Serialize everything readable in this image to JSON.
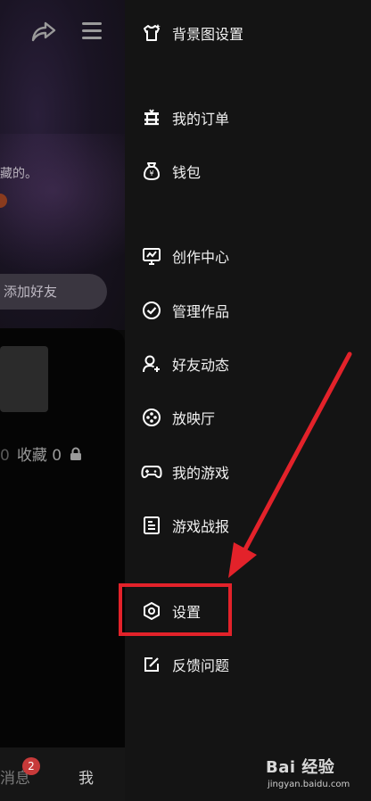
{
  "profile": {
    "bio_fragment": "藏的。",
    "add_friend_label": "添加好友",
    "favorites_partial": "0",
    "favorites_label": "收藏 0",
    "tabbar": {
      "messages_label": "消息",
      "messages_badge": "2",
      "me_label": "我"
    }
  },
  "drawer": {
    "items": [
      {
        "label": "背景图设置",
        "icon": "shirt-icon"
      },
      {
        "label": "我的订单",
        "icon": "order-icon"
      },
      {
        "label": "钱包",
        "icon": "wallet-icon"
      },
      {
        "label": "创作中心",
        "icon": "creator-icon"
      },
      {
        "label": "管理作品",
        "icon": "check-circle-icon"
      },
      {
        "label": "好友动态",
        "icon": "friend-activity-icon"
      },
      {
        "label": "放映厅",
        "icon": "film-reel-icon"
      },
      {
        "label": "我的游戏",
        "icon": "gamepad-icon"
      },
      {
        "label": "游戏战报",
        "icon": "report-icon"
      },
      {
        "label": "设置",
        "icon": "settings-hexagon-icon"
      },
      {
        "label": "反馈问题",
        "icon": "feedback-edit-icon"
      }
    ]
  },
  "annotation": {
    "highlight_color": "#e3222a"
  },
  "watermark": {
    "main": "Bai 经验",
    "sub": "jingyan.baidu.com"
  }
}
